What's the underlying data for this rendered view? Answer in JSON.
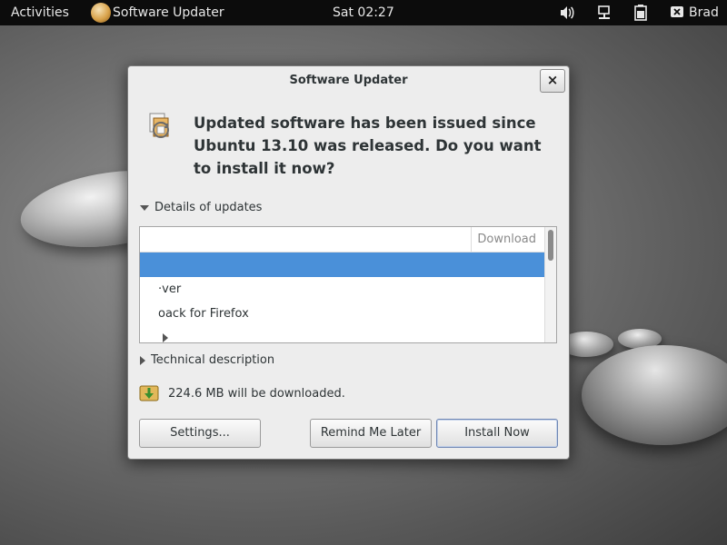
{
  "topbar": {
    "activities": "Activities",
    "app_name": "Software Updater",
    "clock": "Sat 02:27",
    "user": "Brad"
  },
  "dialog": {
    "title": "Software Updater",
    "close_label": "×",
    "headline": "Updated software has been issued since Ubuntu 13.10 was released. Do you want to install it now?",
    "details_expander": "Details of updates",
    "list": {
      "column_download": "Download",
      "rows": [
        {
          "text": "",
          "selected": true
        },
        {
          "text": "·ver",
          "selected": false
        },
        {
          "text": "oack for Firefox",
          "selected": false
        },
        {
          "text": "",
          "selected": false,
          "expander": true
        }
      ]
    },
    "technical_expander": "Technical description",
    "download_size": "224.6 MB will be downloaded.",
    "buttons": {
      "settings": "Settings...",
      "remind": "Remind Me Later",
      "install": "Install Now"
    }
  },
  "colors": {
    "selection": "#4a90d9",
    "topbar_bg": "#0c0c0c",
    "dialog_bg": "#ededed"
  },
  "icons": [
    "app-icon",
    "volume-icon",
    "network-icon",
    "battery-icon",
    "user-icon",
    "updater-icon",
    "download-icon"
  ]
}
